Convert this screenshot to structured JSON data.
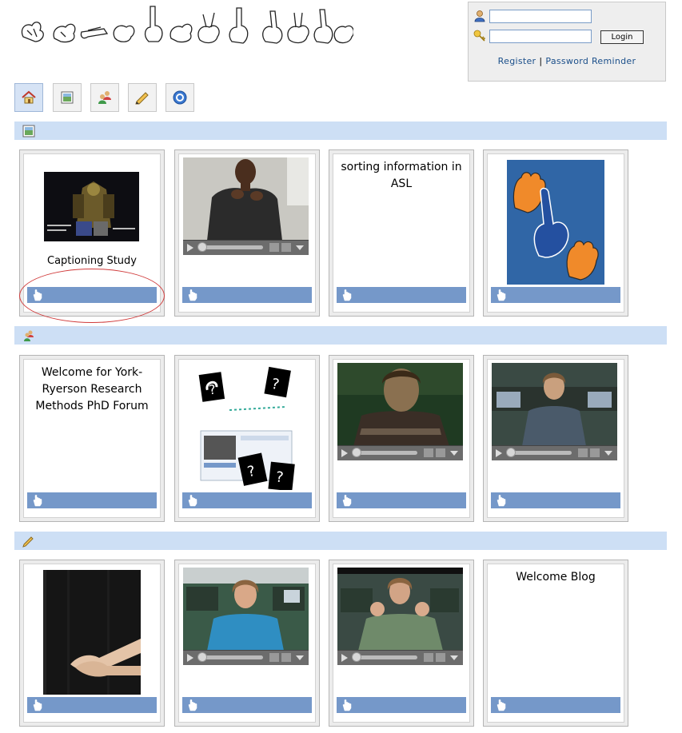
{
  "header": {
    "logo_icon": "fingerspelled-site-logo"
  },
  "login": {
    "username_value": "",
    "password_value": "",
    "login_label": "Login",
    "register_label": "Register",
    "separator": "|",
    "reminder_label": "Password Reminder",
    "user_icon": "user-icon",
    "key_icon": "key-icon"
  },
  "toolbar": {
    "items": [
      {
        "icon": "home-icon",
        "active": true
      },
      {
        "icon": "picture-icon"
      },
      {
        "icon": "people-icon"
      },
      {
        "icon": "pencil-icon"
      },
      {
        "icon": "help-icon"
      }
    ]
  },
  "sections": [
    {
      "icon": "picture-icon",
      "cards": [
        {
          "type": "image",
          "image": "captioning-study-thumbnail",
          "title": "Captioning Study"
        },
        {
          "type": "video",
          "image": "signing-man-video"
        },
        {
          "type": "text",
          "title": "sorting information in ASL"
        },
        {
          "type": "image",
          "image": "asl-handshapes-logo"
        }
      ]
    },
    {
      "icon": "people-icon",
      "cards": [
        {
          "type": "text",
          "title": "Welcome for York-Ryerson Research Methods PhD Forum"
        },
        {
          "type": "image",
          "image": "question-marks-collage"
        },
        {
          "type": "video",
          "image": "signing-woman-dark-video"
        },
        {
          "type": "video",
          "image": "signing-woman-lab-video"
        }
      ]
    },
    {
      "icon": "pencil-icon",
      "cards": [
        {
          "type": "image",
          "image": "signing-hands-photo"
        },
        {
          "type": "video",
          "image": "signing-woman-teal-video"
        },
        {
          "type": "video",
          "image": "signing-woman-gesture-video"
        },
        {
          "type": "text",
          "title": "Welcome Blog"
        }
      ]
    }
  ],
  "colors": {
    "section_bar": "#cddff5",
    "action_bar": "#7598c9",
    "link": "#1b4f8a"
  }
}
